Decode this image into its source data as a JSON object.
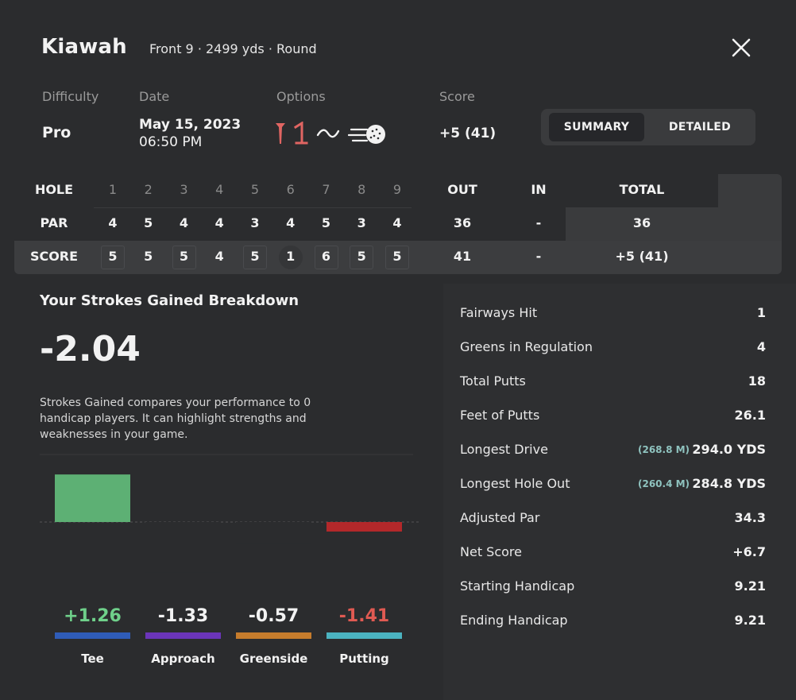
{
  "header": {
    "course": "Kiawah",
    "subtitle": "Front 9 · 2499 yds · Round"
  },
  "meta": {
    "difficulty_label": "Difficulty",
    "difficulty": "Pro",
    "date_label": "Date",
    "date": "May 15, 2023",
    "time": "06:50 PM",
    "options_label": "Options",
    "options_icons": [
      "tee-icon",
      "mulligan-icon",
      "wind-icon",
      "ball-icon"
    ],
    "score_label": "Score",
    "score": "+5 (41)"
  },
  "toggle": {
    "summary": "SUMMARY",
    "detailed": "DETAILED",
    "active": "summary"
  },
  "scorecard": {
    "row_labels": {
      "hole": "HOLE",
      "par": "PAR",
      "score": "SCORE"
    },
    "holes": [
      "1",
      "2",
      "3",
      "4",
      "5",
      "6",
      "7",
      "8",
      "9"
    ],
    "par": [
      "4",
      "5",
      "4",
      "4",
      "3",
      "4",
      "5",
      "3",
      "4"
    ],
    "score": [
      "5",
      "5",
      "5",
      "4",
      "5",
      "1",
      "6",
      "5",
      "5"
    ],
    "score_marks": [
      "box",
      "none",
      "box",
      "none",
      "box",
      "circle",
      "box",
      "box",
      "box"
    ],
    "headers": {
      "out": "OUT",
      "in": "IN",
      "total": "TOTAL"
    },
    "par_out": "36",
    "par_in": "-",
    "par_total": "36",
    "score_out": "41",
    "score_in": "-",
    "score_total": "+5 (41)"
  },
  "strokes_gained": {
    "title": "Your Strokes Gained Breakdown",
    "value": "-2.04",
    "description": "Strokes Gained compares your performance to 0 handicap players. It can highlight strengths and weaknesses in your game."
  },
  "chart_data": {
    "type": "bar",
    "categories": [
      "Tee",
      "Approach",
      "Greenside",
      "Putting"
    ],
    "values": [
      1.26,
      -1.33,
      -0.57,
      -1.41
    ],
    "value_labels": [
      "+1.26",
      "-1.33",
      "-0.57",
      "-1.41"
    ],
    "colors": {
      "positive": "#5db074",
      "negative": "#b3282a",
      "tee": "#2f5cb8",
      "approach": "#6b35b9",
      "greenside": "#c67c2c",
      "putting": "#4bb3c0",
      "label_positive": "#6fd08a",
      "label_negative": "#e05a52"
    },
    "ylim": [
      -4,
      2
    ],
    "grid": false,
    "legend": "none"
  },
  "stats": [
    {
      "label": "Fairways Hit",
      "value": "1"
    },
    {
      "label": "Greens in Regulation",
      "value": "4"
    },
    {
      "label": "Total Putts",
      "value": "18"
    },
    {
      "label": "Feet of Putts",
      "value": "26.1"
    },
    {
      "label": "Longest Drive",
      "metric": "(268.8 M)",
      "value": "294.0 YDS"
    },
    {
      "label": "Longest Hole Out",
      "metric": "(260.4 M)",
      "value": "284.8 YDS"
    },
    {
      "label": "Adjusted Par",
      "value": "34.3"
    },
    {
      "label": "Net Score",
      "value": "+6.7"
    },
    {
      "label": "Starting Handicap",
      "value": "9.21"
    },
    {
      "label": "Ending Handicap",
      "value": "9.21"
    }
  ]
}
